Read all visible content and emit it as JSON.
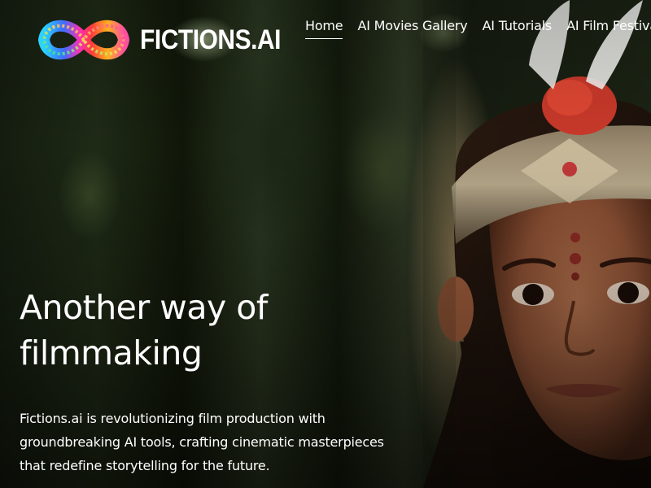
{
  "header": {
    "logo_text": "FICTIONS.AI",
    "nav": [
      {
        "label": "Home",
        "active": true
      },
      {
        "label": "AI Movies Gallery",
        "active": false
      },
      {
        "label": "AI Tutorials",
        "active": false
      },
      {
        "label": "AI Film Festival",
        "active": false
      }
    ]
  },
  "hero": {
    "title": "Another way of filmmaking",
    "description": "Fictions.ai is revolutionizing film production with groundbreaking AI tools, crafting cinematic masterpieces that redefine storytelling for the future."
  },
  "icons": {
    "logo": "infinity-film-reel-icon"
  },
  "colors": {
    "text": "#ffffff",
    "background": "#141c0f"
  }
}
